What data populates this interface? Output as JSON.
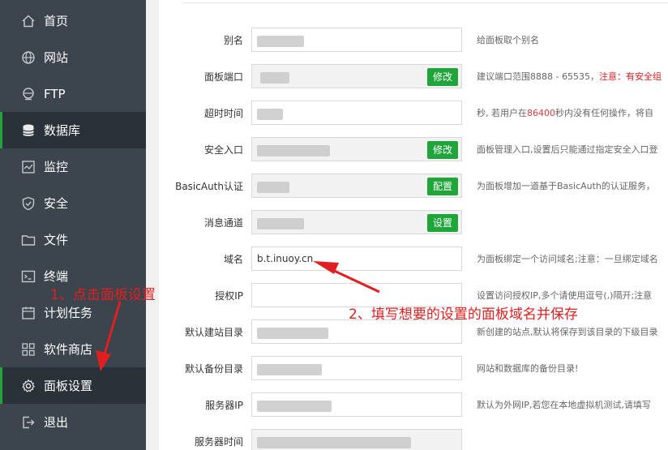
{
  "sidebar": {
    "items": [
      {
        "label": "首页",
        "icon": "home-icon"
      },
      {
        "label": "网站",
        "icon": "globe-icon"
      },
      {
        "label": "FTP",
        "icon": "ftp-icon"
      },
      {
        "label": "数据库",
        "icon": "database-icon"
      },
      {
        "label": "监控",
        "icon": "monitor-icon"
      },
      {
        "label": "安全",
        "icon": "shield-icon"
      },
      {
        "label": "文件",
        "icon": "folder-icon"
      },
      {
        "label": "终端",
        "icon": "terminal-icon"
      },
      {
        "label": "计划任务",
        "icon": "calendar-icon"
      },
      {
        "label": "软件商店",
        "icon": "apps-icon"
      },
      {
        "label": "面板设置",
        "icon": "gear-icon"
      },
      {
        "label": "退出",
        "icon": "logout-icon"
      }
    ],
    "active": "数据库"
  },
  "form": {
    "alias": {
      "label": "别名",
      "help": "给面板取个别名"
    },
    "port": {
      "label": "面板端口",
      "button": "修改",
      "help": "建议端口范围8888 - 65535，",
      "help_warn": "注意：有安全组"
    },
    "timeout": {
      "label": "超时时间",
      "help_pre": "秒, 若用户在",
      "help_num": "86400",
      "help_post": "秒内没有任何操作，将自"
    },
    "entry": {
      "label": "安全入口",
      "button": "修改",
      "help": "面板管理入口,设置后只能通过指定安全入口登"
    },
    "basicauth": {
      "label": "BasicAuth认证",
      "button": "配置",
      "help": "为面板增加一道基于BasicAuth的认证服务，"
    },
    "notify": {
      "label": "消息通道",
      "button": "设置"
    },
    "domain": {
      "label": "域名",
      "value": "b.t.inuoy.cn",
      "help": "为面板绑定一个访问域名;注意：一旦绑定域名"
    },
    "auth_ip": {
      "label": "授权IP",
      "help": "设置访问授权IP,多个请使用逗号(,)隔开;注意"
    },
    "site_dir": {
      "label": "默认建站目录",
      "help": "新创建的站点,默认将保存到该目录的下级目录"
    },
    "backup_dir": {
      "label": "默认备份目录",
      "help": "网站和数据库的备份目录!"
    },
    "server_ip": {
      "label": "服务器IP",
      "help": "默认为外网IP,若您在本地虚拟机测试,请填写"
    },
    "server_time": {
      "label": "服务器时间"
    }
  },
  "annotations": {
    "step1": "1、点击面板设置",
    "step2": "2、填写想要的设置的面板域名并保存"
  },
  "colors": {
    "sidebar_bg": "#3c444d",
    "sidebar_active_bg": "#2b3138",
    "accent": "#20a53a",
    "annotation": "#e02020"
  }
}
